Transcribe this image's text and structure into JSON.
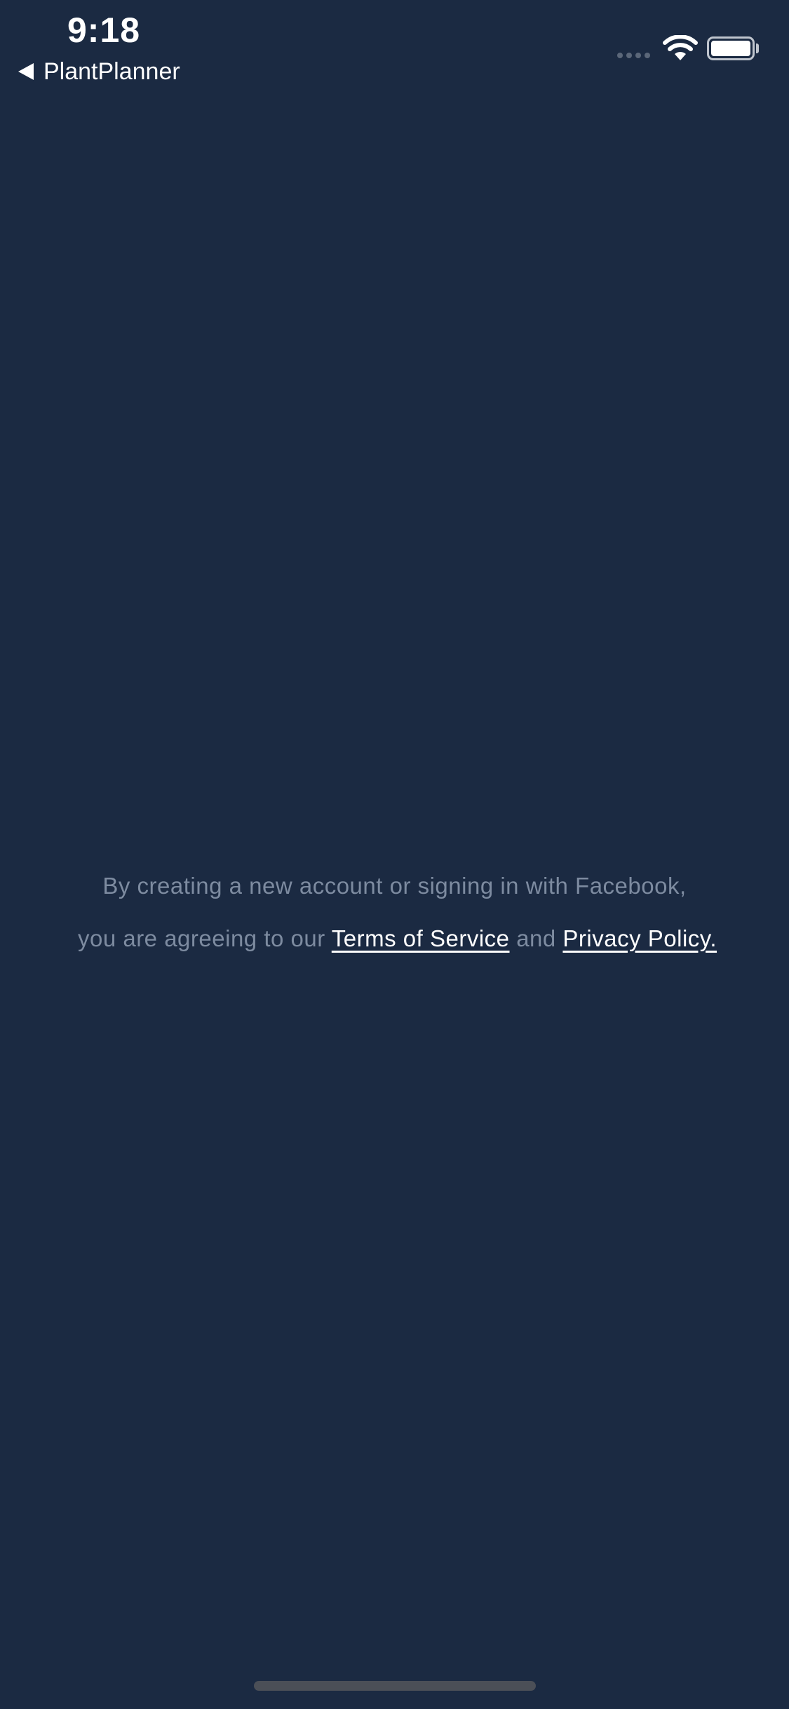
{
  "status_bar": {
    "time": "9:18",
    "back_label": "PlantPlanner"
  },
  "legal": {
    "line1": "By creating a new account or signing in with Facebook,",
    "line2_prefix": "you are agreeing to our",
    "terms_label": "Terms of Service",
    "conjunction": "and",
    "privacy_label": "Privacy Policy."
  },
  "icons": {
    "back": "chevron-left-icon",
    "signal": "signal-dots-icon",
    "wifi": "wifi-icon",
    "battery": "battery-icon"
  },
  "colors": {
    "background": "#1b2a42",
    "muted_text": "#7d8ba0",
    "link_text": "#ffffff"
  }
}
